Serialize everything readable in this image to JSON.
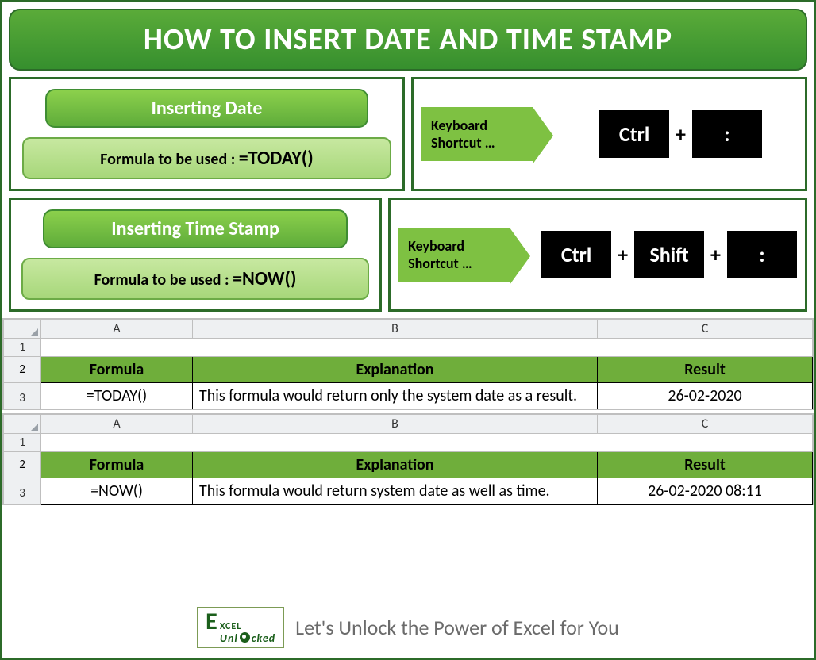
{
  "title": "HOW TO INSERT DATE AND TIME STAMP",
  "section1": {
    "heading": "Inserting Date",
    "formula_label": "Formula to be used : ",
    "formula_fn": "=TODAY()",
    "shortcut_label": "Keyboard Shortcut …",
    "keys": [
      "Ctrl",
      ":"
    ]
  },
  "section2": {
    "heading": "Inserting Time Stamp",
    "formula_label": "Formula to be used : ",
    "formula_fn": "=NOW()",
    "shortcut_label": "Keyboard Shortcut …",
    "keys": [
      "Ctrl",
      "Shift",
      ":"
    ]
  },
  "sheet_cols": [
    "A",
    "B",
    "C"
  ],
  "sheet_rows": [
    "1",
    "2",
    "3"
  ],
  "table_headers": [
    "Formula",
    "Explanation",
    "Result"
  ],
  "table1": {
    "formula": "=TODAY()",
    "explanation": "This formula would return only the system date as a result.",
    "result": "26-02-2020"
  },
  "table2": {
    "formula": "=NOW()",
    "explanation": "This formula would return system date as well as time.",
    "result": "26-02-2020 08:11"
  },
  "footer": {
    "brand1": "E",
    "brand2": "XCEL",
    "brand_sub": "Unl  cked",
    "tagline": "Let's Unlock the Power of Excel for You"
  }
}
